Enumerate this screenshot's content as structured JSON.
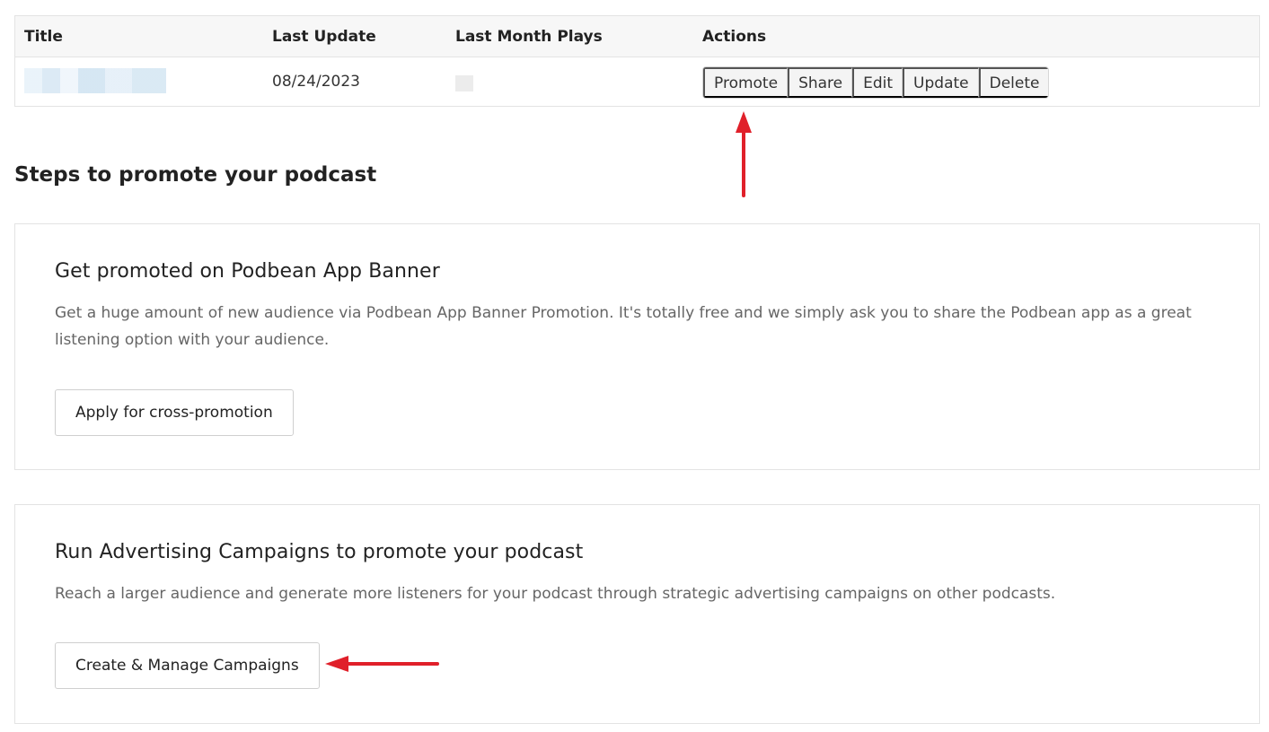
{
  "table": {
    "headers": {
      "title": "Title",
      "last_update": "Last Update",
      "last_month_plays": "Last Month Plays",
      "actions": "Actions"
    },
    "rows": [
      {
        "last_update": "08/24/2023",
        "actions": [
          "Promote",
          "Share",
          "Edit",
          "Update",
          "Delete"
        ]
      }
    ]
  },
  "steps": {
    "heading": "Steps to promote your podcast",
    "cards": [
      {
        "title": "Get promoted on Podbean App Banner",
        "description": "Get a huge amount of new audience via Podbean App Banner Promotion. It's totally free and we simply ask you to share the Podbean app as a great listening option with your audience.",
        "button_label": "Apply for cross-promotion"
      },
      {
        "title": "Run Advertising Campaigns to promote your podcast",
        "description": "Reach a larger audience and generate more listeners for your podcast through strategic advertising campaigns on other podcasts.",
        "button_label": "Create & Manage Campaigns"
      }
    ]
  },
  "annotations": {
    "arrow_color": "#e0202a"
  }
}
